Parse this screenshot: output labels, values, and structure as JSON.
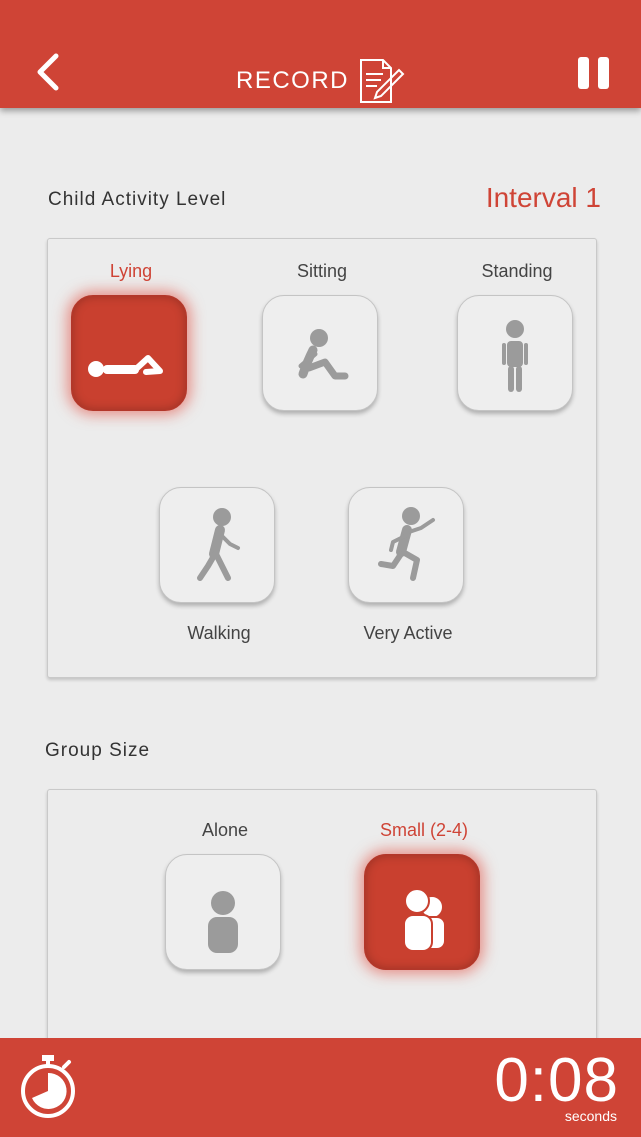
{
  "header": {
    "title": "RECORD",
    "back_icon": "chevron-left-icon",
    "title_icon": "document-edit-icon",
    "pause_icon": "pause-icon"
  },
  "activity": {
    "heading": "Child Activity Level",
    "interval": "Interval 1",
    "options": [
      {
        "label": "Lying",
        "icon": "lying-person-icon",
        "selected": true
      },
      {
        "label": "Sitting",
        "icon": "sitting-person-icon",
        "selected": false
      },
      {
        "label": "Standing",
        "icon": "standing-person-icon",
        "selected": false
      },
      {
        "label": "Walking",
        "icon": "walking-person-icon",
        "selected": false
      },
      {
        "label": "Very Active",
        "icon": "running-person-icon",
        "selected": false
      }
    ]
  },
  "group": {
    "heading": "Group Size",
    "options": [
      {
        "label": "Alone",
        "icon": "single-person-icon",
        "selected": false
      },
      {
        "label": "Small (2-4)",
        "icon": "small-group-icon",
        "selected": true
      }
    ]
  },
  "footer": {
    "timer": "0:08",
    "unit": "seconds",
    "stopwatch_icon": "stopwatch-icon"
  },
  "colors": {
    "accent": "#cf4436",
    "background": "#ececec",
    "icon_gray": "#9b9b9b"
  }
}
